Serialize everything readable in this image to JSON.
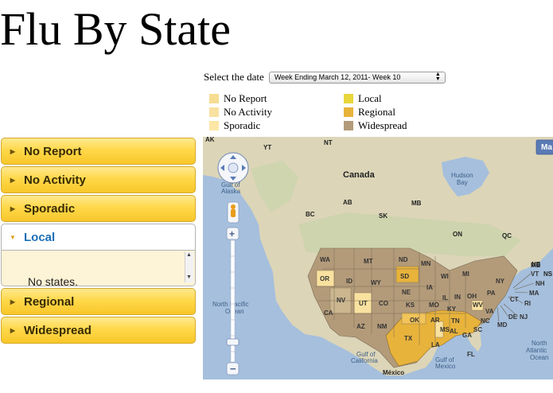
{
  "page": {
    "title": "Flu By State"
  },
  "date_selector": {
    "label": "Select the date",
    "selected": "Week Ending March 12, 2011- Week 10"
  },
  "legend": [
    {
      "label": "No Report",
      "color": "#f7dd92"
    },
    {
      "label": "No Activity",
      "color": "#f9e19f"
    },
    {
      "label": "Sporadic",
      "color": "#fce7a6"
    },
    {
      "label": "Local",
      "color": "#e8d63a"
    },
    {
      "label": "Regional",
      "color": "#e8b33b"
    },
    {
      "label": "Widespread",
      "color": "#b39b7a"
    }
  ],
  "accordion": {
    "items": [
      {
        "label": "No Report"
      },
      {
        "label": "No Activity"
      },
      {
        "label": "Sporadic"
      },
      {
        "label": "Local",
        "active": true,
        "content": "No states."
      },
      {
        "label": "Regional"
      },
      {
        "label": "Widespread"
      }
    ]
  },
  "map": {
    "type_button": "Ma",
    "places": {
      "AK": "AK",
      "YT": "YT",
      "NT": "NT",
      "canada": "Canada",
      "hudson": "Hudson",
      "bay": "Bay",
      "gulf1": "Gulf of",
      "alaska": "Alaska",
      "AB": "AB",
      "BC": "BC",
      "SK": "SK",
      "MB": "MB",
      "ON": "ON",
      "QC": "QC",
      "NB": "NB",
      "NS": "NS",
      "npac1": "North Pacific",
      "npac2": "Ocean",
      "natl1": "North",
      "natl2": "Atlantic",
      "natl3": "Ocean",
      "gcal1": "Gulf of",
      "gcal2": "California",
      "gmex1": "Gulf of",
      "gmex2": "Mexico",
      "mexico": "México"
    },
    "states": {
      "WA": "WA",
      "OR": "OR",
      "CA": "CA",
      "ID": "ID",
      "NV": "NV",
      "MT": "MT",
      "WY": "WY",
      "UT": "UT",
      "AZ": "AZ",
      "CO": "CO",
      "NM": "NM",
      "ND": "ND",
      "SD": "SD",
      "NE": "NE",
      "KS": "KS",
      "OK": "OK",
      "TX": "TX",
      "MN": "MN",
      "IA": "IA",
      "MO": "MO",
      "AR": "AR",
      "LA": "LA",
      "WI": "WI",
      "IL": "IL",
      "MS": "MS",
      "MI": "MI",
      "IN": "IN",
      "KY": "KY",
      "TN": "TN",
      "AL": "AL",
      "OH": "OH",
      "WV": "WV",
      "GA": "GA",
      "FL": "FL",
      "SC": "SC",
      "NC": "NC",
      "VA": "VA",
      "PA": "PA",
      "NY": "NY",
      "MD": "MD",
      "DE": "DE",
      "NJ": "NJ",
      "CT": "CT",
      "RI": "RI",
      "MA": "MA",
      "VT": "VT",
      "NH": "NH",
      "ME": "ME"
    }
  }
}
